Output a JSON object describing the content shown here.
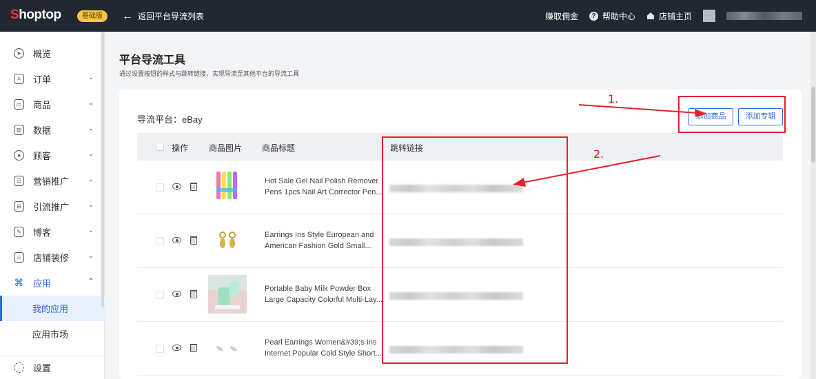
{
  "topbar": {
    "logo_first": "S",
    "logo_rest": "hoptop",
    "plan_badge": "基础版",
    "back_label": "返回平台导流列表",
    "links": [
      "赚取佣金",
      "帮助中心",
      "店铺主页"
    ]
  },
  "sidebar": {
    "items": [
      {
        "label": "概览"
      },
      {
        "label": "订单"
      },
      {
        "label": "商品"
      },
      {
        "label": "数据"
      },
      {
        "label": "顾客"
      },
      {
        "label": "营销推广"
      },
      {
        "label": "引流推广"
      },
      {
        "label": "博客"
      },
      {
        "label": "店铺装修"
      },
      {
        "label": "应用"
      }
    ],
    "sub_items": [
      "我的应用",
      "应用市场"
    ],
    "settings_label": "设置"
  },
  "page": {
    "title": "平台导流工具",
    "subtitle": "通过设置按钮的样式与跳转链接，实现导流至其他平台的导流工具",
    "platform_label": "导流平台：eBay",
    "add_goods_button": "添加商品",
    "add_collection_button": "添加专辑"
  },
  "table": {
    "headers": [
      "操作",
      "商品图片",
      "商品标题",
      "跳转链接"
    ],
    "rows": [
      {
        "title_line1": "Hot Sale Gel Nail Polish Remover",
        "title_line2": "Pens 1pcs Nail Art Corrector Pen..."
      },
      {
        "title_line1": "Earrings Ins Style European and",
        "title_line2": "American Fashion Gold Small..."
      },
      {
        "title_line1": "Portable Baby Milk Powder Box",
        "title_line2": "Large Capacity Colorful Multi-Lay..."
      },
      {
        "title_line1": "Pearl Earrings Women&#39;s Ins",
        "title_line2": "Internet Popular Cold Style Short..."
      }
    ]
  },
  "annotations": {
    "step1": "1.",
    "step2": "2."
  },
  "colors": {
    "topbar_bg": "#222831",
    "accent": "#2f6be0",
    "annotation_red": "#e5212a",
    "badge_yellow": "#f5c542"
  }
}
